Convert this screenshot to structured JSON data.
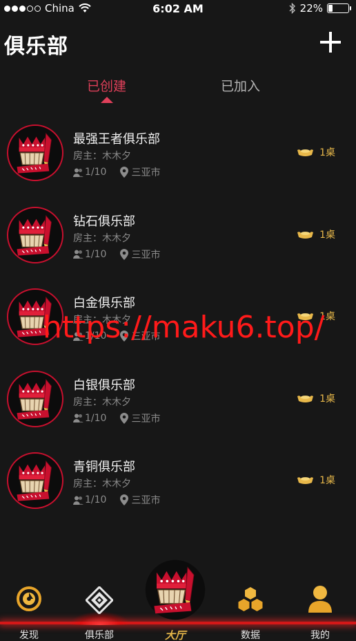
{
  "status_bar": {
    "carrier": "China",
    "time": "6:02 AM",
    "battery_percent": "22%",
    "battery_level": 0.22,
    "signal_dots_filled": 3,
    "signal_dots_total": 5
  },
  "header": {
    "title": "俱乐部",
    "add_icon": "plus-icon"
  },
  "tabs": [
    {
      "label": "已创建",
      "active": true
    },
    {
      "label": "已加入",
      "active": false
    }
  ],
  "clubs": [
    {
      "name": "最强王者俱乐部",
      "owner": "房主：木木夕",
      "members": "1/10",
      "city": "三亚市",
      "tables": "1桌"
    },
    {
      "name": "钻石俱乐部",
      "owner": "房主：木木夕",
      "members": "1/10",
      "city": "三亚市",
      "tables": "1桌"
    },
    {
      "name": "白金俱乐部",
      "owner": "房主：木木夕",
      "members": "1/10",
      "city": "三亚市",
      "tables": "1桌"
    },
    {
      "name": "白银俱乐部",
      "owner": "房主：木木夕",
      "members": "1/10",
      "city": "三亚市",
      "tables": "1桌"
    },
    {
      "name": "青铜俱乐部",
      "owner": "房主：木木夕",
      "members": "1/10",
      "city": "三亚市",
      "tables": "1桌"
    }
  ],
  "watermark": "https://maku6.top/",
  "bottom_nav": [
    {
      "label": "发现",
      "icon": "target-icon",
      "active": false
    },
    {
      "label": "俱乐部",
      "icon": "diamond-emblem-icon",
      "active": true
    },
    {
      "label": "大厅",
      "icon": "crazy-crown-logo",
      "active": false
    },
    {
      "label": "数据",
      "icon": "hexagons-icon",
      "active": false
    },
    {
      "label": "我的",
      "icon": "user-icon",
      "active": false
    }
  ],
  "colors": {
    "accent": "#e0405a",
    "gold": "#e8b84a",
    "background": "#171717",
    "glow_red": "#d41818"
  }
}
